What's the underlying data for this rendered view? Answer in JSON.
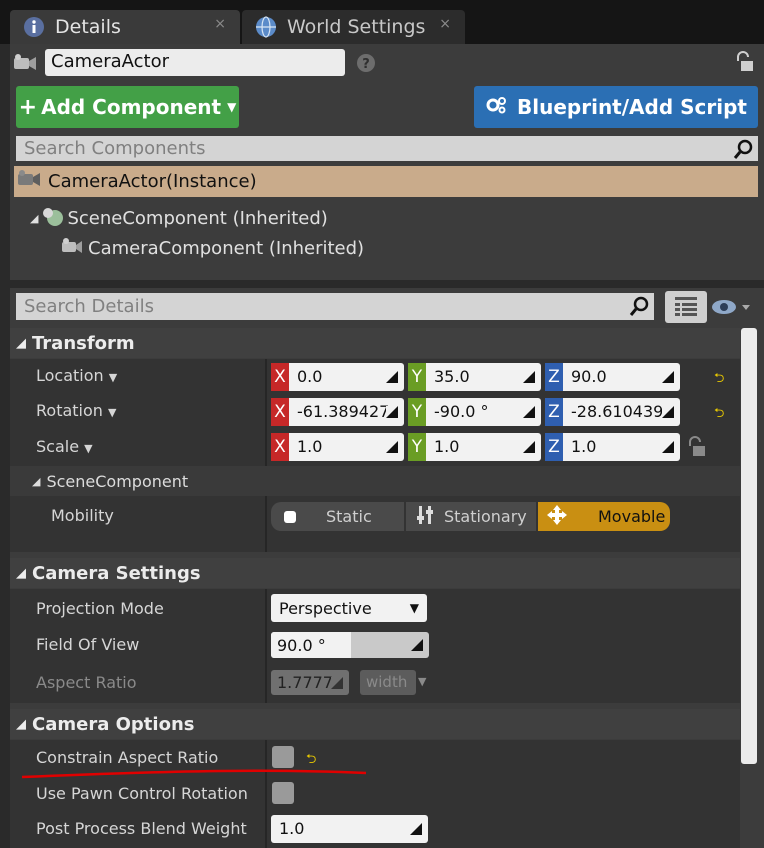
{
  "tabs": [
    {
      "label": "Details",
      "close": "×"
    },
    {
      "label": "World Settings",
      "close": "×"
    }
  ],
  "actor_name": "CameraActor",
  "buttons": {
    "add_component": "Add Component",
    "blueprint": "Blueprint/Add Script"
  },
  "search_components_placeholder": "Search Components",
  "instance_label": "CameraActor(Instance)",
  "tree": [
    "SceneComponent (Inherited)",
    "CameraComponent (Inherited)"
  ],
  "search_details_placeholder": "Search Details",
  "transform": {
    "title": "Transform",
    "location": {
      "label": "Location",
      "x": "0.0",
      "y": "35.0",
      "z": "90.0"
    },
    "rotation": {
      "label": "Rotation",
      "x": "-61.389427",
      "y": "-90.0 °",
      "z": "-28.610439"
    },
    "scale": {
      "label": "Scale",
      "x": "1.0",
      "y": "1.0",
      "z": "1.0"
    },
    "scene_component": "SceneComponent",
    "mobility": {
      "label": "Mobility",
      "options": [
        "Static",
        "Stationary",
        "Movable"
      ],
      "selected": "Movable"
    }
  },
  "axis_letters": {
    "x": "X",
    "y": "Y",
    "z": "Z"
  },
  "camera_settings": {
    "title": "Camera Settings",
    "projection_mode": {
      "label": "Projection Mode",
      "value": "Perspective"
    },
    "field_of_view": {
      "label": "Field Of View",
      "value": "90.0 °"
    },
    "aspect_ratio": {
      "label": "Aspect Ratio",
      "value": "1.7777",
      "unit": "width"
    }
  },
  "camera_options": {
    "title": "Camera Options",
    "constrain_aspect_ratio": {
      "label": "Constrain Aspect Ratio",
      "checked": false
    },
    "use_pawn_control_rotation": {
      "label": "Use Pawn Control Rotation",
      "checked": false
    },
    "post_process_blend_weight": {
      "label": "Post Process Blend Weight",
      "value": "1.0"
    }
  },
  "colors": {
    "add_button": "#43a047",
    "blueprint_button": "#2b6fb4",
    "movable_selected": "#c98f12",
    "instance_highlight": "#c9ab8b",
    "annotation_underline": "#e00000"
  }
}
